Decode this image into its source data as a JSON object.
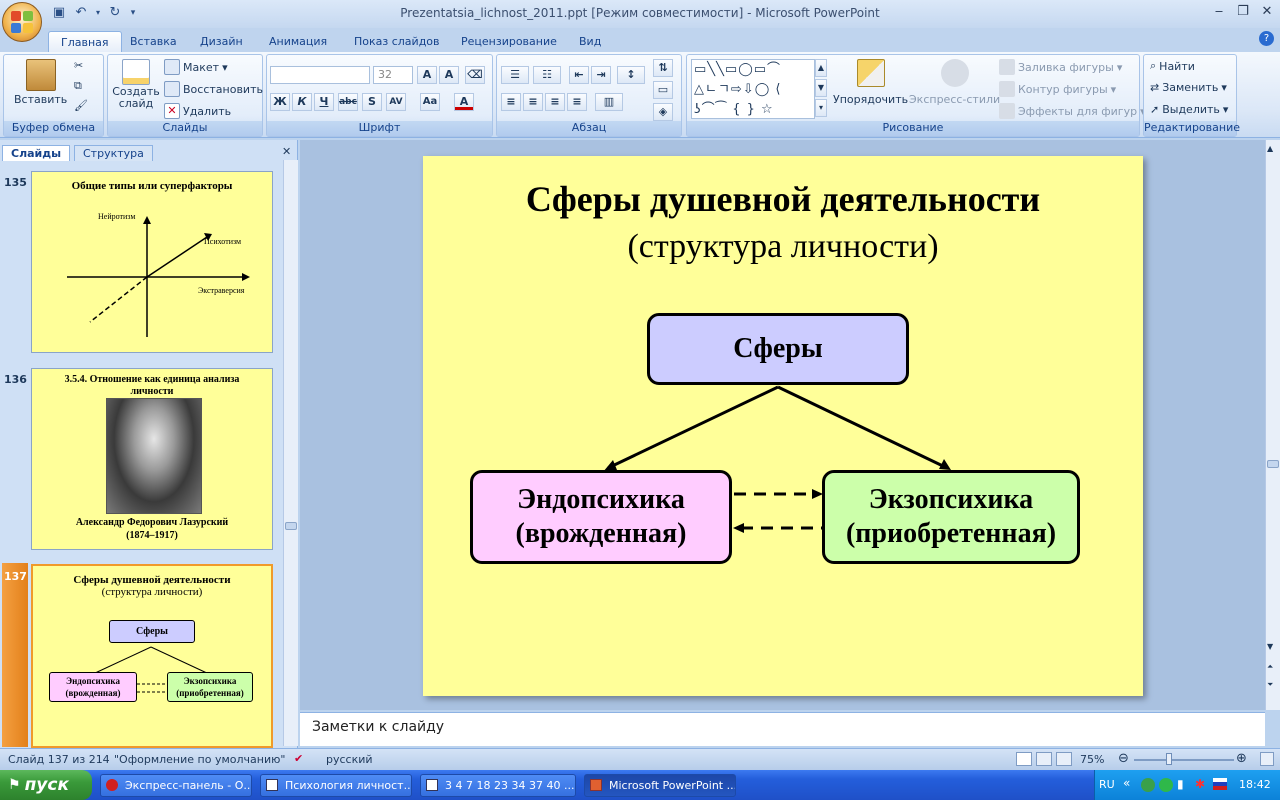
{
  "window": {
    "title": "Prezentatsia_lichnost_2011.ppt [Режим совместимости] - Microsoft PowerPoint"
  },
  "ribbon_tabs": [
    "Главная",
    "Вставка",
    "Дизайн",
    "Анимация",
    "Показ слайдов",
    "Рецензирование",
    "Вид"
  ],
  "ribbon": {
    "clipboard": {
      "paste": "Вставить",
      "label": "Буфер обмена"
    },
    "slides": {
      "new_slide": "Создать слайд",
      "layout": "Макет",
      "reset": "Восстановить",
      "delete": "Удалить",
      "label": "Слайды"
    },
    "font": {
      "size": "32",
      "label": "Шрифт"
    },
    "paragraph": {
      "label": "Абзац"
    },
    "drawing": {
      "arrange": "Упорядочить",
      "quick_styles": "Экспресс-стили",
      "fill": "Заливка фигуры",
      "outline": "Контур фигуры",
      "effects": "Эффекты для фигур",
      "label": "Рисование"
    },
    "editing": {
      "find": "Найти",
      "replace": "Заменить",
      "select": "Выделить",
      "label": "Редактирование"
    }
  },
  "panel_tabs": {
    "slides": "Слайды",
    "outline": "Структура"
  },
  "thumbnails": [
    {
      "number": "135",
      "title": "Общие типы или суперфакторы",
      "labels": {
        "neuro": "Нейротизм",
        "psycho": "Психотизм",
        "extra": "Экстраверсия"
      }
    },
    {
      "number": "136",
      "title": "3.5.4. Отношение как единица анализа личности",
      "caption": "Александр Федорович Лазурский",
      "years": "(1874–1917)"
    },
    {
      "number": "137",
      "title": "Сферы душевной деятельности",
      "subtitle": "(структура личности)",
      "top": "Сферы",
      "left": "Эндопсихика (врожденная)",
      "right": "Экзопсихика (приобретенная)"
    }
  ],
  "slide": {
    "title": "Сферы душевной деятельности",
    "subtitle": "(структура личности)",
    "top_box": "Сферы",
    "left_box_line1": "Эндопсихика",
    "left_box_line2": "(врожденная)",
    "right_box_line1": "Экзопсихика",
    "right_box_line2": "(приобретенная)",
    "colors": {
      "background": "#ffff99",
      "top": "#ccccff",
      "left": "#ffccff",
      "right": "#ccffaa"
    }
  },
  "notes": {
    "placeholder": "Заметки к слайду"
  },
  "status": {
    "slide_of": "Слайд 137 из 214",
    "theme": "\"Оформление по умолчанию\"",
    "language": "русский",
    "zoom": "75%"
  },
  "taskbar": {
    "start": "пуск",
    "tasks": [
      "Экспресс-панель - О...",
      "Психология личност...",
      "3 4 7 18 23 34 37 40 ...",
      "Microsoft PowerPoint ..."
    ],
    "lang": "RU",
    "time": "18:42"
  }
}
